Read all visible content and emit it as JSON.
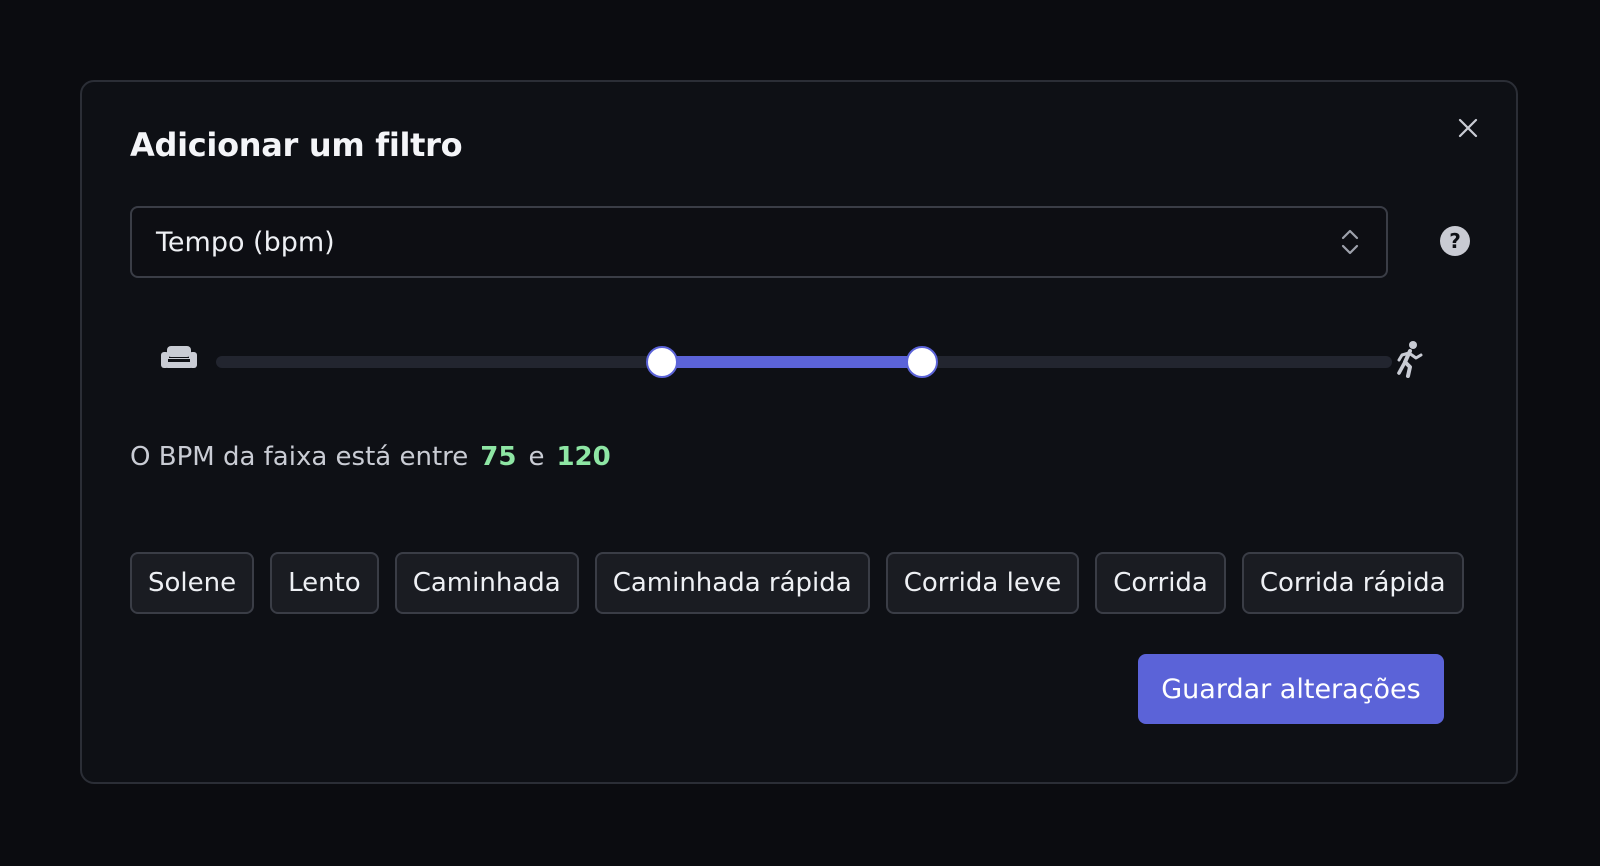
{
  "dialog": {
    "title": "Adicionar um filtro",
    "close_icon": "close-icon"
  },
  "filter_select": {
    "value": "Tempo (bpm)",
    "chevron_icon": "chevron-up-down-icon"
  },
  "help": {
    "icon": "question-circle-icon",
    "glyph": "?"
  },
  "slider": {
    "min_icon": "sofa-icon",
    "max_icon": "running-person-icon",
    "low_fraction": 0.379,
    "high_fraction": 0.6
  },
  "range_summary": {
    "prefix": "O BPM da faixa está entre",
    "low": "75",
    "joiner": "e",
    "high": "120"
  },
  "presets": [
    "Solene",
    "Lento",
    "Caminhada",
    "Caminhada rápida",
    "Corrida leve",
    "Corrida",
    "Corrida rápida"
  ],
  "actions": {
    "save_label": "Guardar alterações"
  },
  "colors": {
    "accent": "#5b63d8",
    "value_green": "#8ee6a4",
    "background": "#0b0c10"
  }
}
